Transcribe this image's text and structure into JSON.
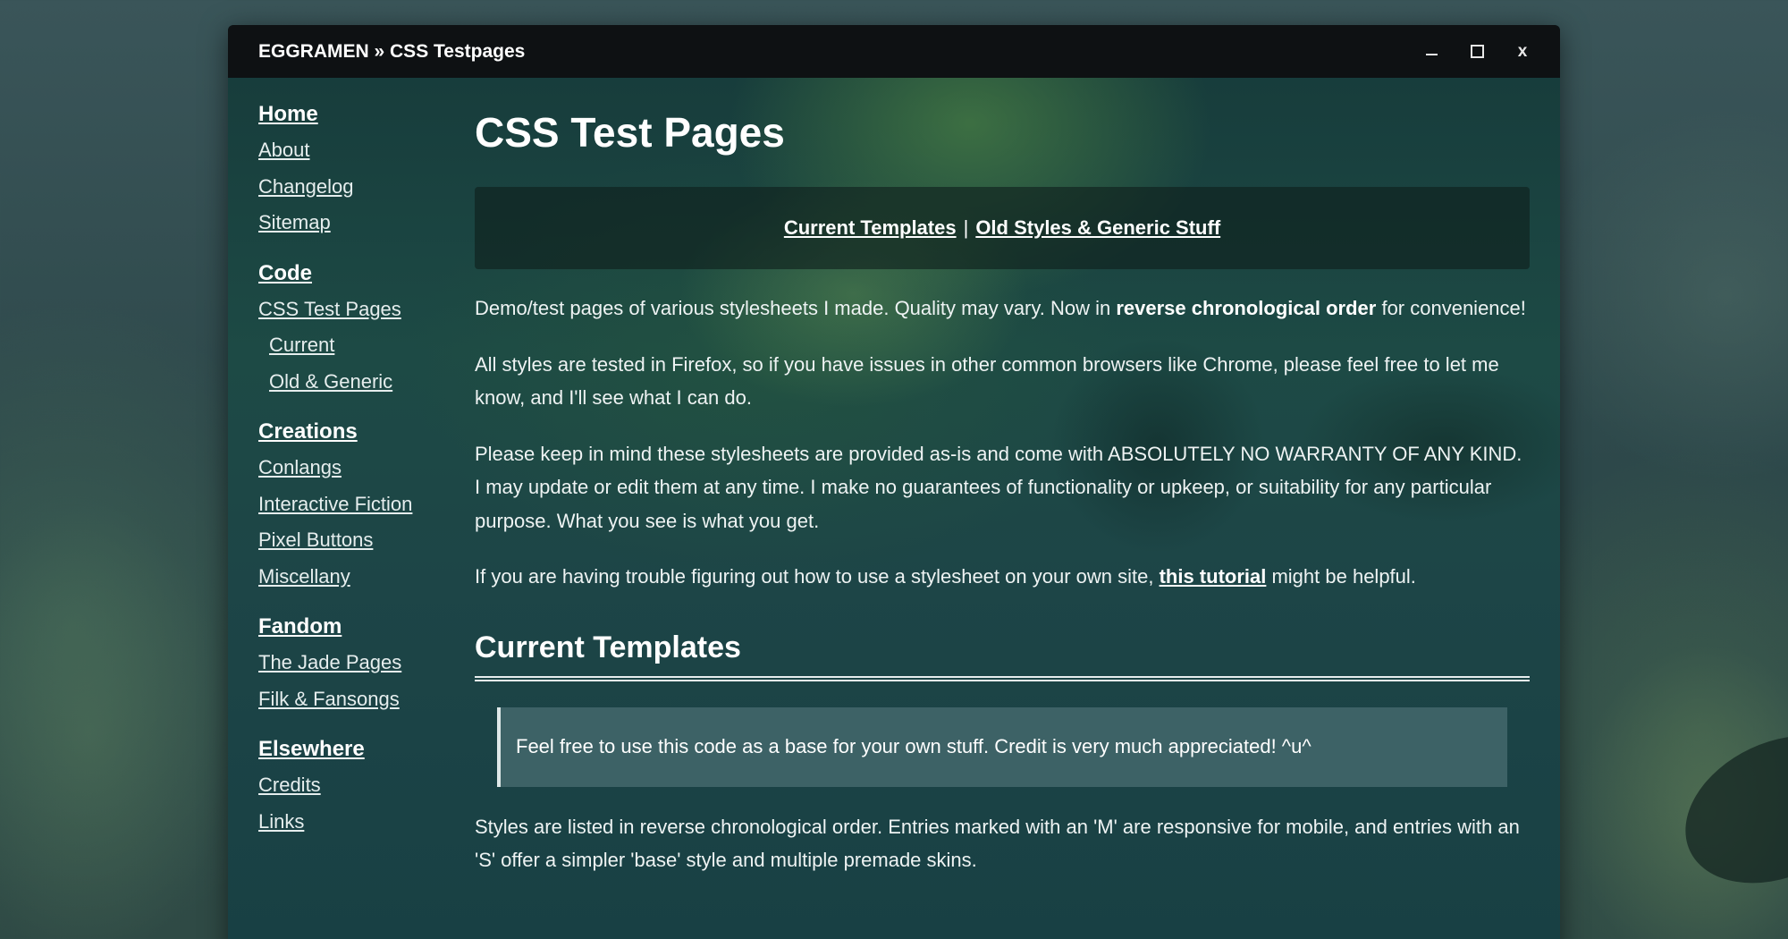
{
  "window": {
    "title": "EGGRAMEN » CSS Testpages",
    "controls": {
      "minimize_icon": "minimize-icon",
      "maximize_icon": "maximize-icon",
      "close_label": "x"
    }
  },
  "sidebar": {
    "sections": [
      {
        "heading": "Home",
        "items": [
          {
            "label": "About"
          },
          {
            "label": "Changelog"
          },
          {
            "label": "Sitemap"
          }
        ]
      },
      {
        "heading": "Code",
        "items": [
          {
            "label": "CSS Test Pages"
          },
          {
            "label": "Current",
            "sub": true
          },
          {
            "label": "Old & Generic",
            "sub": true
          }
        ]
      },
      {
        "heading": "Creations",
        "items": [
          {
            "label": "Conlangs"
          },
          {
            "label": "Interactive Fiction"
          },
          {
            "label": "Pixel Buttons"
          },
          {
            "label": "Miscellany"
          }
        ]
      },
      {
        "heading": "Fandom",
        "items": [
          {
            "label": "The Jade Pages"
          },
          {
            "label": "Filk & Fansongs"
          }
        ]
      },
      {
        "heading": "Elsewhere",
        "items": [
          {
            "label": "Credits"
          },
          {
            "label": "Links"
          }
        ]
      }
    ]
  },
  "main": {
    "title": "CSS Test Pages",
    "jump": {
      "link1": "Current Templates",
      "separator": "|",
      "link2": "Old Styles & Generic Stuff"
    },
    "para1": {
      "before": "Demo/test pages of various stylesheets I made. Quality may vary. Now in ",
      "bold": "reverse chronological order",
      "after": " for convenience!"
    },
    "para2": "All styles are tested in Firefox, so if you have issues in other common browsers like Chrome, please feel free to let me know, and I'll see what I can do.",
    "para3": "Please keep in mind these stylesheets are provided as-is and come with ABSOLUTELY NO WARRANTY OF ANY KIND. I may update or edit them at any time. I make no guarantees of functionality or upkeep, or suitability for any particular purpose. What you see is what you get.",
    "para4": {
      "before": "If you are having trouble figuring out how to use a stylesheet on your own site, ",
      "link": "this tutorial",
      "after": " might be helpful."
    },
    "section_title": "Current Templates",
    "notice": "Feel free to use this code as a base for your own stuff. Credit is very much appreciated! ^u^",
    "para5": "Styles are listed in reverse chronological order. Entries marked with an 'M' are responsive for mobile, and entries with an 'S' offer a simpler 'base' style and multiple premade skins."
  }
}
